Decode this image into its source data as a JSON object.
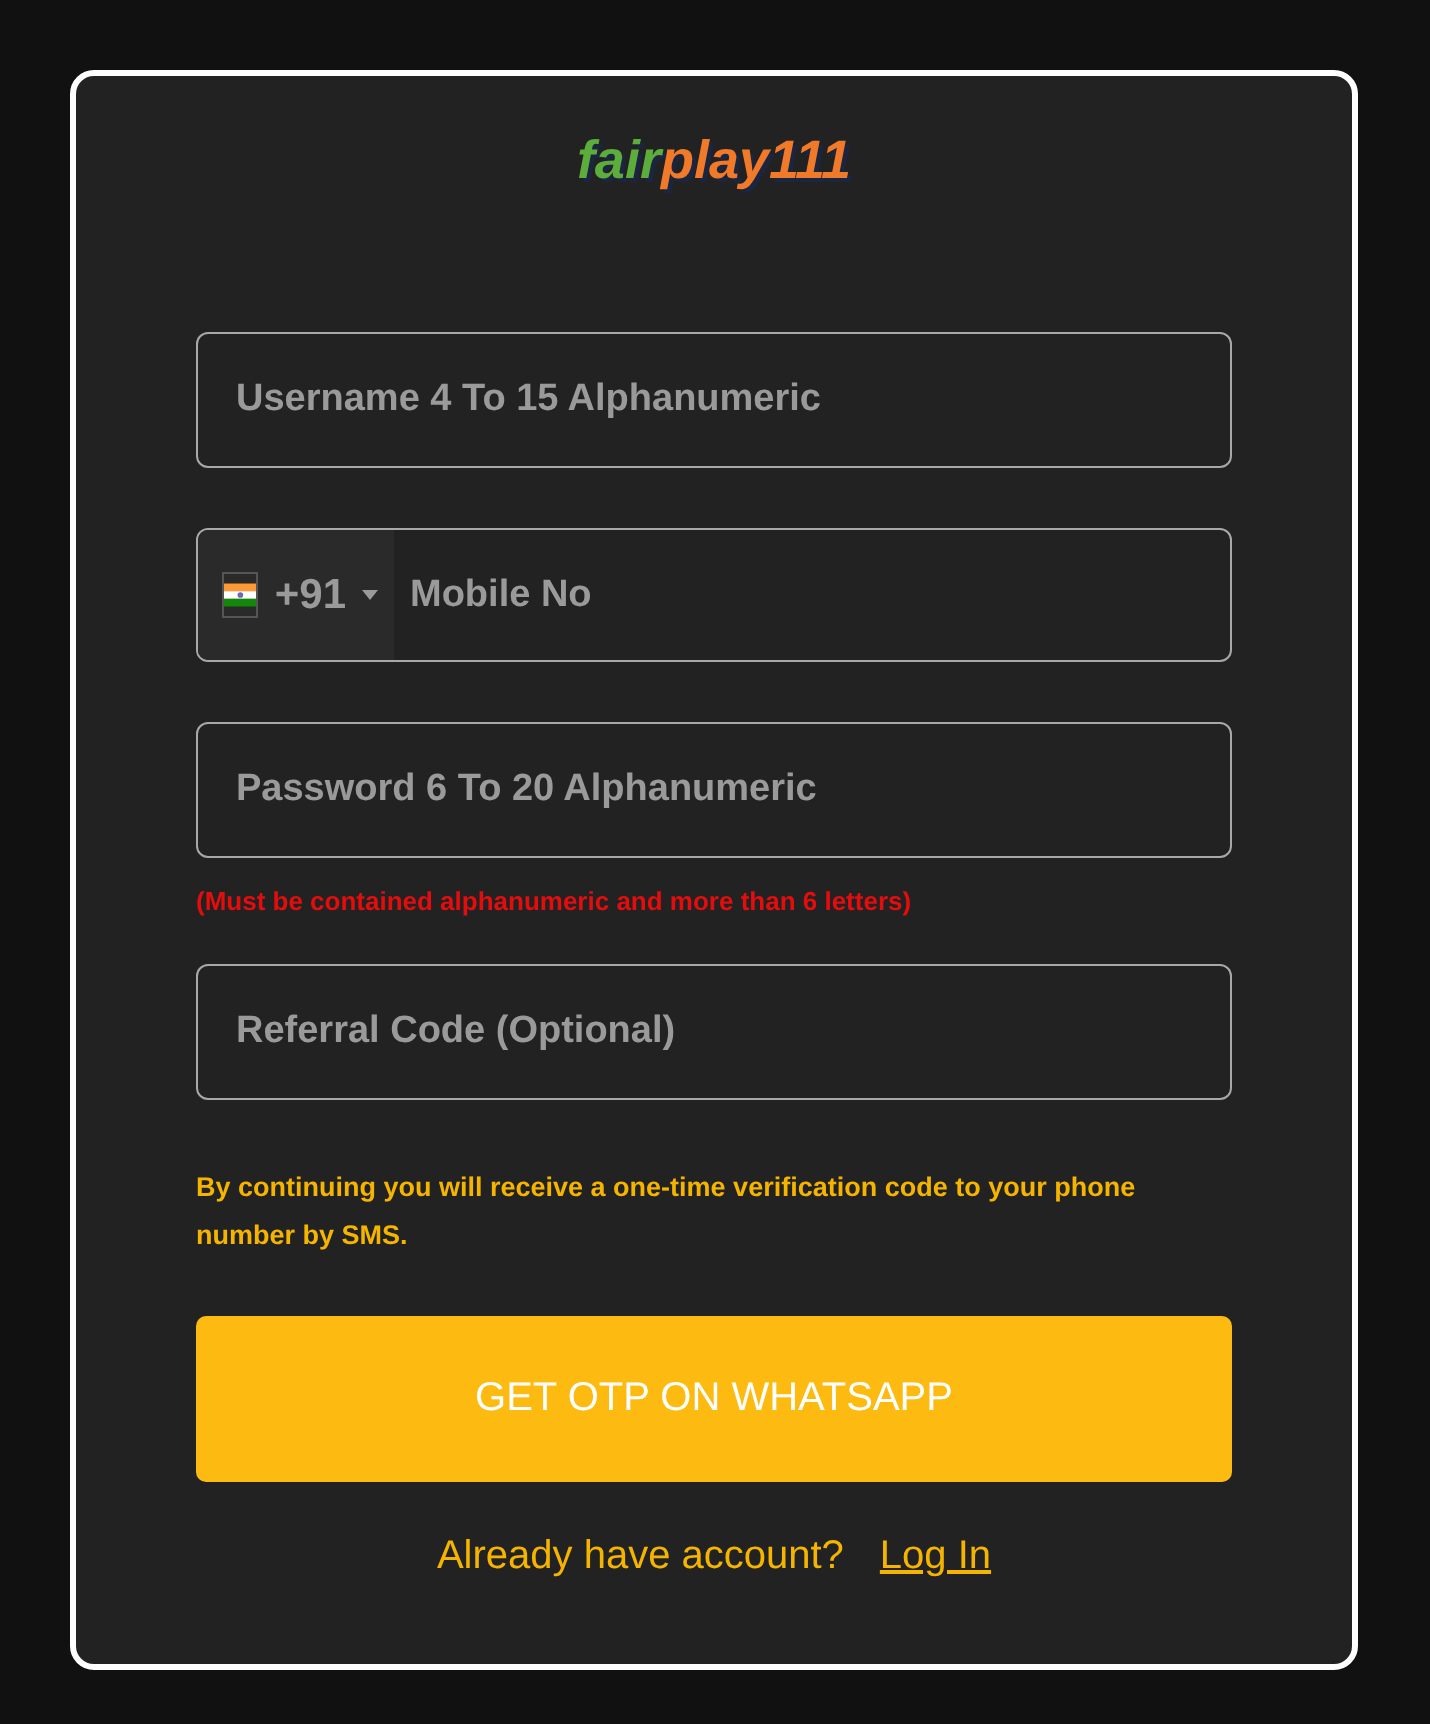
{
  "logo": [
    {
      "text": "fair",
      "color": "#5cad3c"
    },
    {
      "text": "play111",
      "color": "#f07a2a"
    }
  ],
  "fields": [
    {
      "kind": "text",
      "placeholder": "Username 4 To 15 Alphanumeric"
    },
    {
      "kind": "phone",
      "country_code": "+91",
      "placeholder": "Mobile No"
    },
    {
      "kind": "text",
      "placeholder": "Password 6 To 20 Alphanumeric",
      "hint": "(Must be contained alphanumeric and more than 6 letters)"
    },
    {
      "kind": "text",
      "placeholder": "Referral Code (Optional)"
    }
  ],
  "notice": "By continuing you will receive a one-time verification code to your phone number by SMS.",
  "submit_button": "GET OTP ON WHATSAPP",
  "login_prompt": "Already have account?",
  "login_link": "Log In"
}
